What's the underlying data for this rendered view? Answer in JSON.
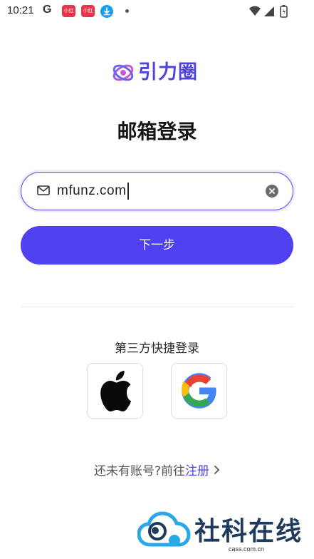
{
  "status_bar": {
    "time": "10:21",
    "g_label": "G",
    "app_icon_1": "小红书",
    "app_icon_2": "小红书"
  },
  "brand": {
    "name": "引力圈",
    "accent_color": "#4f40f0"
  },
  "page": {
    "title": "邮箱登录"
  },
  "email_field": {
    "value": "mfunz.com"
  },
  "next_button": {
    "label": "下一步"
  },
  "quick_login": {
    "label": "第三方快捷登录",
    "providers": [
      "apple-icon",
      "google-icon"
    ]
  },
  "register": {
    "prompt": "还未有账号?前往",
    "link": "注册"
  },
  "watermark": {
    "title": "社科在线",
    "subtitle": "cass.com.cn"
  }
}
